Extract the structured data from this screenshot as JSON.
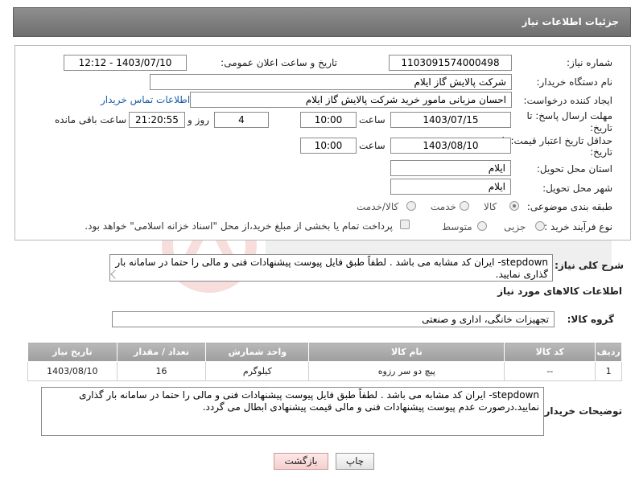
{
  "header": {
    "title": "جزئیات اطلاعات نیاز"
  },
  "form": {
    "need_number_label": "شماره نیاز:",
    "need_number": "1103091574000498",
    "announce_datetime_label": "تاریخ و ساعت اعلان عمومی:",
    "announce_datetime": "1403/07/10 - 12:12",
    "buyer_org_label": "نام دستگاه خریدار:",
    "buyer_org": "شرکت پالایش گاز ایلام",
    "requester_label": "ایجاد کننده درخواست:",
    "requester": "احسان مزبانی مامور خرید شرکت پالایش گاز ایلام",
    "contact_link": "اطلاعات تماس خریدار",
    "reply_deadline_label": "مهلت ارسال پاسخ: تا",
    "reply_deadline_label2": "تاریخ:",
    "reply_date": "1403/07/15",
    "time_label": "ساعت",
    "reply_time": "10:00",
    "days_value": "4",
    "days_label": "روز و",
    "remaining_time": "21:20:55",
    "remaining_label": "ساعت باقی مانده",
    "validity_label": "حداقل تاریخ اعتبار قیمت: تا",
    "validity_label2": "تاریخ:",
    "validity_date": "1403/08/10",
    "validity_time": "10:00",
    "province_label": "استان محل تحویل:",
    "province": "ایلام",
    "city_label": "شهر محل تحویل:",
    "city": "ایلام",
    "category_label": "طبقه بندی موضوعی:",
    "category_options": [
      "کالا",
      "خدمت",
      "کالا/خدمت"
    ],
    "process_label": "نوع فرآیند خرید :",
    "process_options": [
      "جزیی",
      "متوسط"
    ],
    "payment_note": "پرداخت تمام یا بخشی از مبلغ خرید،از محل \"اسناد خزانه اسلامی\" خواهد بود."
  },
  "description": {
    "label": "شرح کلی نیاز:",
    "text": "stepdown- ایران کد مشابه می باشد . لطفاً طبق فایل پیوست پیشنهادات فنی و مالی را حتما در سامانه بار گذاری نمایید."
  },
  "goods": {
    "section_title": "اطلاعات کالاهای مورد نیاز",
    "group_label": "گروه کالا:",
    "group_value": "تجهیزات خانگی، اداری و صنعتی",
    "columns": [
      "ردیف",
      "کد کالا",
      "نام کالا",
      "واحد شمارش",
      "تعداد / مقدار",
      "تاریخ نیاز"
    ],
    "rows": [
      [
        "1",
        "--",
        "پیچ دو سر رزوه",
        "کیلوگرم",
        "16",
        "1403/08/10"
      ]
    ]
  },
  "buyer_notes": {
    "label": "توضیحات خریدار:",
    "text": "stepdown- ایران کد مشابه می باشد . لطفاً طبق فایل پیوست پیشنهادات فنی و مالی را حتما در سامانه بار گذاری نمایید.درصورت عدم پیوست پیشنهادات فنی و مالی قیمت پیشنهادی ابطال می گردد."
  },
  "buttons": {
    "print": "چاپ",
    "back": "بازگشت"
  },
  "colors": {
    "header_bg": "#7f7f7f",
    "link": "#1a5ea8",
    "table_header": "#a9a9a9",
    "back_button": "#f5cfcf"
  }
}
